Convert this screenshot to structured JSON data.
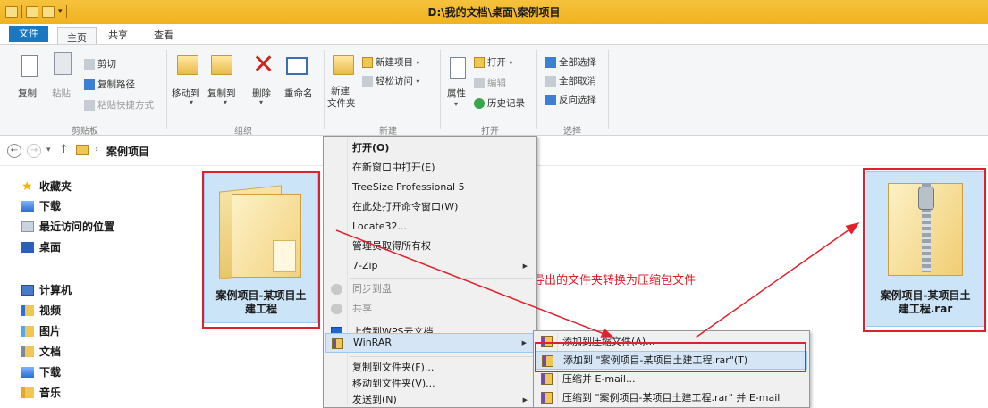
{
  "window": {
    "title": "D:\\我的文档\\桌面\\案例项目"
  },
  "ribbon_tabs": {
    "file": "文件",
    "home": "主页",
    "share": "共享",
    "view": "查看"
  },
  "ribbon": {
    "clipboard": {
      "copy": "复制",
      "paste": "粘贴",
      "cut": "剪切",
      "copy_path": "复制路径",
      "paste_shortcut": "粘贴快捷方式",
      "label": "剪贴板"
    },
    "organize": {
      "move_to": "移动到",
      "copy_to": "复制到",
      "delete": "删除",
      "rename": "重命名",
      "label": "组织"
    },
    "new": {
      "new_folder": "新建",
      "new_folder_line2": "文件夹",
      "new_item": "新建项目",
      "easy_access": "轻松访问",
      "label": "新建"
    },
    "open": {
      "properties": "属性",
      "open": "打开",
      "edit": "编辑",
      "history": "历史记录",
      "label": "打开"
    },
    "select": {
      "select_all": "全部选择",
      "select_none": "全部取消",
      "invert": "反向选择",
      "label": "选择"
    }
  },
  "address": {
    "path": "案例项目"
  },
  "sidebar": {
    "favorites": "收藏夹",
    "downloads": "下载",
    "recent": "最近访问的位置",
    "desktop": "桌面",
    "computer": "计算机",
    "videos": "视频",
    "pictures": "图片",
    "documents": "文档",
    "downloads2": "下载",
    "music": "音乐"
  },
  "items": {
    "folder_line1": "案例项目-某项目土",
    "folder_line2": "建工程",
    "rar_line1": "案例项目-某项目土",
    "rar_line2": "建工程.rar"
  },
  "annotation": "将导出的文件夹转换为压缩包文件",
  "context_menu": {
    "open": "打开(O)",
    "open_new_window": "在新窗口中打开(E)",
    "treesize": "TreeSize Professional 5",
    "open_cmd_here": "在此处打开命令窗口(W)",
    "locate32": "Locate32...",
    "take_ownership": "管理员取得所有权",
    "seven_zip": "7-Zip",
    "sync_disk": "同步到盘",
    "share": "共享",
    "upload_wps": "上传到WPS云文档",
    "winrar": "WinRAR",
    "copy_to_folder": "复制到文件夹(F)...",
    "move_to_folder": "移动到文件夹(V)...",
    "send_to": "发送到(N)"
  },
  "submenu": {
    "add_to_archive": "添加到压缩文件(A)...",
    "add_to_named": "添加到 \"案例项目-某项目土建工程.rar\"(T)",
    "compress_email": "压缩并 E-mail...",
    "compress_named_email": "压缩到 \"案例项目-某项目土建工程.rar\" 并 E-mail"
  },
  "colors": {
    "titlebar": "#f0b21f",
    "file_tab": "#1a78c2",
    "selection": "#cce4f7",
    "annotation_red": "#e0202a"
  }
}
